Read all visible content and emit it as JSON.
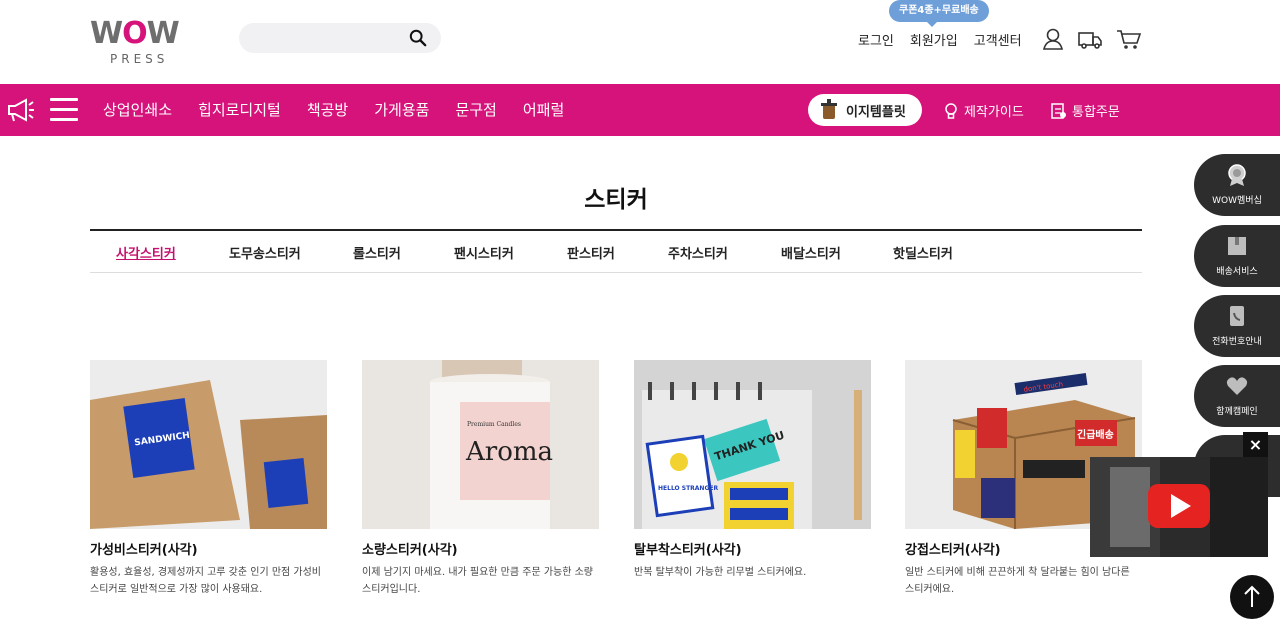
{
  "header": {
    "logo_text_left": "W",
    "logo_text_mid": "O",
    "logo_text_right": "W",
    "logo_sub": "PRESS",
    "search_placeholder": "",
    "coupon_badge": "쿠폰4종+무료배송",
    "links": [
      "로그인",
      "회원가입",
      "고객센터"
    ],
    "icons": [
      "user-icon",
      "truck-icon",
      "cart-icon"
    ]
  },
  "nav": {
    "items": [
      "상업인쇄소",
      "힙지로디지털",
      "책공방",
      "가게용품",
      "문구점",
      "어패럴"
    ],
    "easy_item": "이지템플릿",
    "guide": "제작가이드",
    "order": "통합주문",
    "color": "#d6137a"
  },
  "page": {
    "title": "스티커",
    "tabs": [
      "사각스티커",
      "도무송스티커",
      "롤스티커",
      "팬시스티커",
      "판스티커",
      "주차스티커",
      "배달스티커",
      "핫딜스티커"
    ],
    "active_tab": "사각스티커"
  },
  "products": [
    {
      "name": "가성비스티커(사각)",
      "desc": "활용성, 효율성, 경제성까지 고루 갖춘 인기 만점 가성비 스티커로 일반적으로 가장 많이 사용돼요.",
      "img_text": "SANDWICH"
    },
    {
      "name": "소량스티커(사각)",
      "desc": "이제 남기지 마세요. 내가 필요한 만큼 주문 가능한 소량 스티커입니다.",
      "img_text": "Aroma",
      "img_sub": "Premium Candles"
    },
    {
      "name": "탈부착스티커(사각)",
      "desc": "반복 탈부착이 가능한 리무벌 스티커에요.",
      "img_text": "THANK YOU",
      "img_sub": "HELLO STRANGER"
    },
    {
      "name": "강접스티커(사각)",
      "desc": "일반 스티커에 비해 끈끈하게 착 달라붙는 힘이 남다른 스티커에요.",
      "img_text": "긴급배송",
      "img_sub": "don't touch"
    }
  ],
  "quick_menu": [
    "WOW멤버십",
    "배송서비스",
    "전화번호안내",
    "함께캠페인"
  ],
  "video": {
    "close": "×"
  }
}
